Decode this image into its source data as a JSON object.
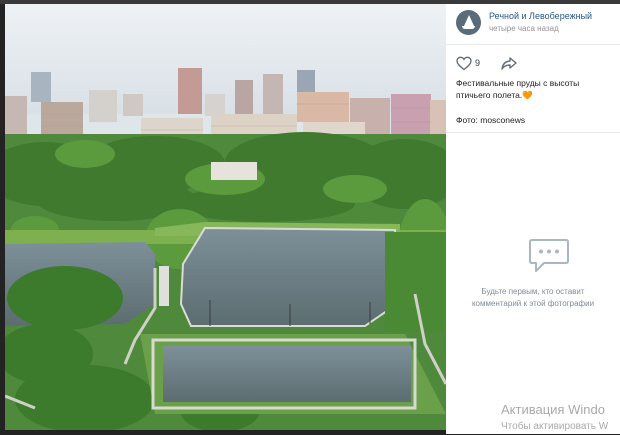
{
  "post": {
    "author": "Речной и Левобережный",
    "time": "четыре часа назад",
    "likes": "9",
    "caption_text": "Фестивальные пруды с высоты птичьего полета.",
    "caption_emoji": "🧡",
    "source": "Фото: mosconews"
  },
  "comments": {
    "empty_line1": "Будьте первым, кто оставит",
    "empty_line2": "комментарий к этой фотографии"
  },
  "icons": {
    "like": "heart-outline-icon",
    "share": "share-arrow-icon",
    "comments": "comment-bubble-icon"
  },
  "colors": {
    "link": "#2a5885",
    "meta": "#939393",
    "like_heart": "#e64646"
  },
  "watermark": {
    "title": "Активация Windo",
    "subtitle": "Чтобы активировать W"
  }
}
